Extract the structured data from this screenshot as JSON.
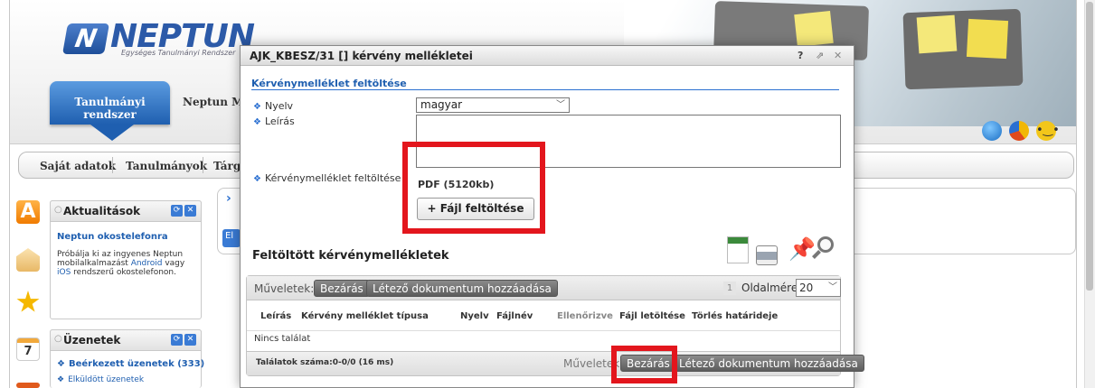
{
  "app": {
    "logo_letter": "N",
    "logo_text": "NEPTUN",
    "logo_subtitle": "Egységes Tanulmányi Rendszer"
  },
  "top_tabs": {
    "active": "Tanulmányi rendszer",
    "other": "Neptun Me"
  },
  "header_icons": {
    "globe": "globe-icon",
    "pie": "pie-chart-icon",
    "face": "smiley-icon",
    "face_glyph": "•‿•"
  },
  "menu": {
    "items": [
      "Saját adatok",
      "Tanulmányok",
      "Tárg"
    ]
  },
  "panels": {
    "news": {
      "title": "Aktualitások",
      "headline": "Neptun okostelefonra",
      "body_1": "Próbálja ki az ingyenes Neptun",
      "body_2_prefix": "mobilalkalmazást ",
      "body_2_link": "Android",
      "body_2_suffix": " vagy",
      "body_3_link": "iOS",
      "body_3_suffix": " rendszerű okostelefonon."
    },
    "messages": {
      "title": "Üzenetek",
      "items": [
        "Beérkezett üzenetek (333)",
        "Elküldött üzenetek"
      ]
    },
    "calendar_number": "7"
  },
  "content": {
    "button_fragment": "El"
  },
  "modal": {
    "title": "AJK_KBESZ/31 [] kérvény mellékletei",
    "controls": {
      "help": "?",
      "popout": "⇗",
      "close": "✕"
    },
    "section_title": "Kérvénymelléklet feltöltése",
    "language_label": "Nyelv",
    "language_value": "magyar",
    "description_label": "Leírás",
    "upload_label": "Kérvénymelléklet feltöltése",
    "file_limit": "PDF (5120kb)",
    "upload_button": "+ Fájl feltöltése",
    "uploaded_title": "Feltöltött kérvénymellékletek",
    "toolbar_icons": [
      "excel-export-icon",
      "print-icon",
      "pin-icon",
      "search-icon"
    ],
    "grid": {
      "ops_label": "Műveletek:",
      "close_button": "Bezárás",
      "add_existing_button": "Létező dokumentum hozzáadása",
      "page_number": "1",
      "page_size_label": "Oldalméret",
      "page_size_value": "20",
      "columns": [
        "Leírás",
        "Kérvény melléklet típusa",
        "Nyelv",
        "Fájlnév",
        "Ellenőrizve",
        "Fájl letöltése",
        "Törlés határideje"
      ],
      "no_results": "Nincs találat",
      "results_count": "Találatok száma:0-0/0 (16 ms)",
      "bottom_ops_label": "Műveletek",
      "bottom_close_button": "Bezárás",
      "bottom_add_existing_button": "Létező dokumentum hozzáadása"
    }
  },
  "colors": {
    "highlight": "#e3161d",
    "accent_blue": "#1f5fb0"
  }
}
